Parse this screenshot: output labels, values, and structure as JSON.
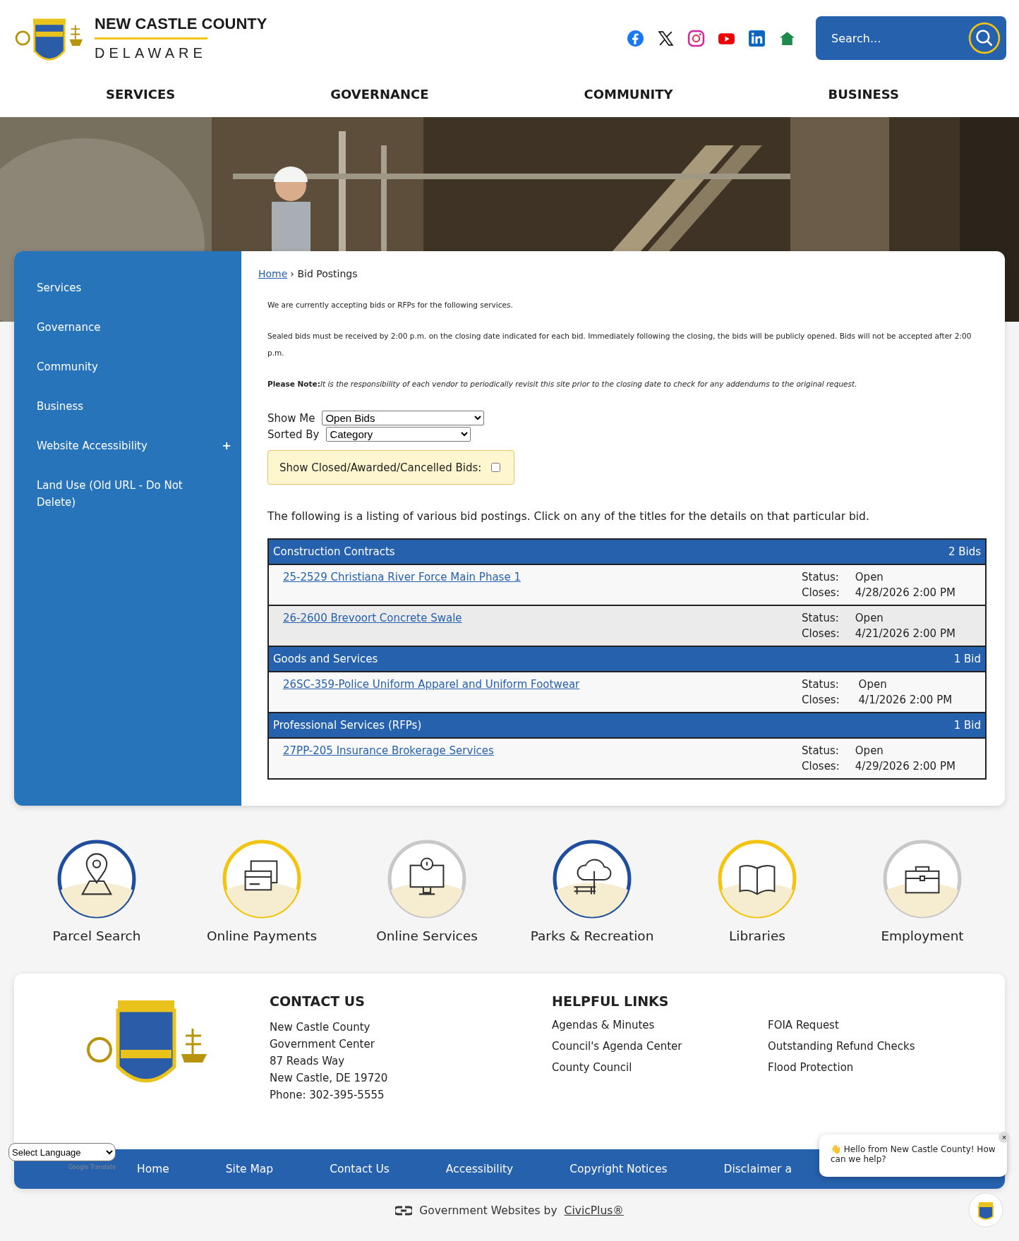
{
  "header": {
    "title": "NEW CASTLE COUNTY",
    "subtitle": "DELAWARE",
    "search": {
      "placeholder": "Search..."
    },
    "social": [
      {
        "kind": "facebook"
      },
      {
        "kind": "x"
      },
      {
        "kind": "instagram"
      },
      {
        "kind": "youtube"
      },
      {
        "kind": "linkedin"
      },
      {
        "kind": "home"
      }
    ]
  },
  "nav": [
    "SERVICES",
    "GOVERNANCE",
    "COMMUNITY",
    "BUSINESS"
  ],
  "hero": {
    "kind": "picture"
  },
  "sidebar": {
    "items": [
      {
        "label": "Services"
      },
      {
        "label": "Governance"
      },
      {
        "label": "Community"
      },
      {
        "label": "Business"
      },
      {
        "label": "Website Accessibility",
        "toggle": "+"
      },
      {
        "label": "Land Use (Old URL - Do Not Delete)"
      }
    ]
  },
  "breadcrumb": {
    "home": "Home",
    "separator": "›",
    "current": "Bid Postings"
  },
  "intro": [
    "We are currently accepting bids or RFPs for the following services.",
    "Sealed bids must be received by 2:00 p.m. on the closing date indicated for each bid. Immediately following the closing, the bids will be publicly opened. Bids will not be accepted after 2:00 p.m.",
    "*It is the responsibility of each vendor to periodically revisit this site prior to the closing date to check for any addendums to the original request.*"
  ],
  "note_label": "Please Note:",
  "filters": [
    {
      "label": "Show Me",
      "value": "Open Bids"
    },
    {
      "label": "Sorted By",
      "value": "Category"
    }
  ],
  "closed_toggle": {
    "label": "Show Closed/Awarded/Cancelled Bids:",
    "checked": false
  },
  "listing_text": "The following is a listing of various bid postings. Click on any of the titles for the details on that particular bid.",
  "categories": [
    {
      "name": "Construction Contracts",
      "count": "2 Bids",
      "bids": [
        {
          "title": "25-2529 Christiana River Force Main Phase 1",
          "status_label": "Status:",
          "status": "Open",
          "closes_label": "Closes:",
          "closes": "4/28/2026 2:00 PM"
        },
        {
          "title": "26-2600 Brevoort Concrete Swale",
          "status_label": "Status:",
          "status": "Open",
          "closes_label": "Closes:",
          "closes": "4/21/2026 2:00 PM"
        }
      ]
    },
    {
      "name": "Goods and Services",
      "count": "1 Bid",
      "bids": [
        {
          "title": "26SC-359-Police Uniform Apparel and Uniform Footwear",
          "status_label": "Status:",
          "status": "Open",
          "closes_label": "Closes:",
          "closes": "4/1/2026 2:00 PM"
        }
      ]
    },
    {
      "name": "Professional Services (RFPs)",
      "count": "1 Bid",
      "bids": [
        {
          "title": "27PP-205 Insurance Brokerage Services",
          "status_label": "Status:",
          "status": "Open",
          "closes_label": "Closes:",
          "closes": "4/29/2026 2:00 PM"
        }
      ]
    }
  ],
  "quick_links": [
    {
      "label": "Parcel Search",
      "kind": "map-pin",
      "color": "#1f4e9c"
    },
    {
      "label": "Online Payments",
      "kind": "cards",
      "color": "#f2c40f"
    },
    {
      "label": "Online Services",
      "kind": "monitor",
      "color": "#c8c8c8"
    },
    {
      "label": "Parks & Recreation",
      "kind": "tree",
      "color": "#1f4e9c"
    },
    {
      "label": "Libraries",
      "kind": "book",
      "color": "#f2c40f"
    },
    {
      "label": "Employment",
      "kind": "briefcase",
      "color": "#c8c8c8"
    }
  ],
  "contact": {
    "heading": "CONTACT US",
    "lines": [
      "New Castle County",
      "Government Center",
      "87 Reads Way",
      "New Castle, DE 19720",
      "Phone: 302-395-5555"
    ]
  },
  "helpful_links": {
    "heading": "HELPFUL LINKS",
    "links": [
      "Agendas & Minutes",
      "FOIA Request",
      "Council's Agenda Center",
      "Outstanding Refund Checks",
      "County Council",
      "Flood Protection"
    ]
  },
  "footer_nav": [
    "Home",
    "Site Map",
    "Contact Us",
    "Accessibility",
    "Copyright Notices",
    "Disclaimer a"
  ],
  "language": {
    "value": "Select Language",
    "credit": "Google Translate"
  },
  "chat": {
    "message": "👋 Hello from New Castle County! How can we help?",
    "close": "×"
  },
  "credit": {
    "text": "Government Websites by",
    "link": "CivicPlus®"
  }
}
